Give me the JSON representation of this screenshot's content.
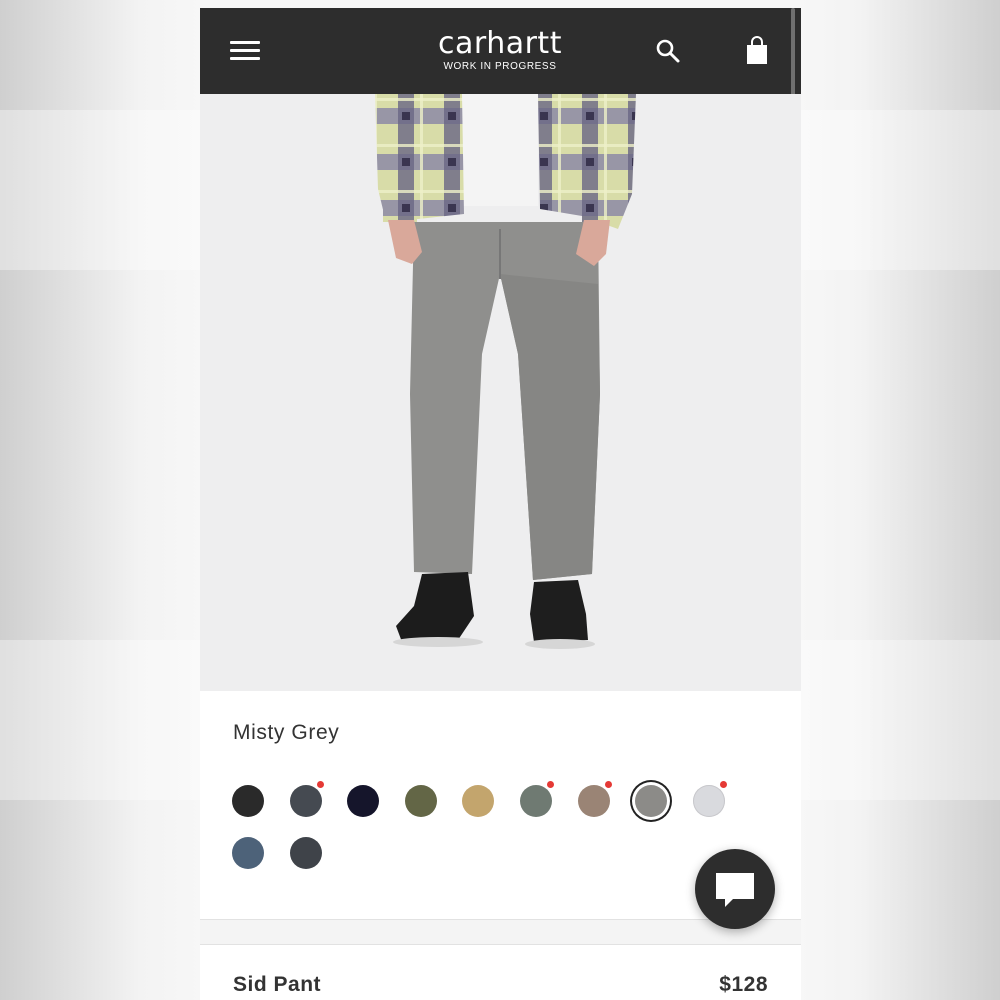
{
  "header": {
    "brand": "carhartt",
    "brand_sub": "WORK IN PROGRESS",
    "menu_icon": "hamburger-menu-icon",
    "search_icon": "search-icon",
    "bag_icon": "shopping-bag-icon",
    "background": "#2d2d2d"
  },
  "product_image": {
    "subject": "model wearing grey chino pants with plaid shirt and black shoes"
  },
  "colors": {
    "selected_name": "Misty Grey",
    "swatches": [
      {
        "color": "#2a2a2a",
        "new": false
      },
      {
        "color": "#454a51",
        "new": true
      },
      {
        "color": "#15152b",
        "new": false
      },
      {
        "color": "#636646",
        "new": false
      },
      {
        "color": "#c3a56d",
        "new": false
      },
      {
        "color": "#6f7a72",
        "new": true
      },
      {
        "color": "#9a8475",
        "new": true
      },
      {
        "color": "#8c8b88",
        "new": false,
        "selected": true
      },
      {
        "color": "#d9dade",
        "new": true
      },
      {
        "color": "#4d6279",
        "new": false
      },
      {
        "color": "#3f4349",
        "new": false
      }
    ]
  },
  "product": {
    "name": "Sid Pant",
    "price": "$128"
  },
  "chat": {
    "icon": "chat-bubble-icon"
  }
}
